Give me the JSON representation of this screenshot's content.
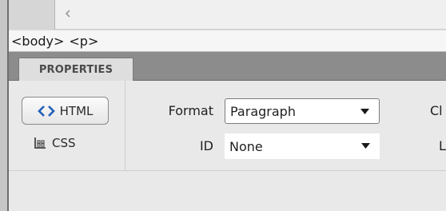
{
  "tag_selector": {
    "tags": [
      "<body>",
      "<p>"
    ]
  },
  "properties_panel": {
    "tab_label": "PROPERTIES",
    "html_button_label": "HTML",
    "css_button_label": "CSS",
    "format_label": "Format",
    "format_value": "Paragraph",
    "id_label": "ID",
    "id_value": "None",
    "class_label_partial": "Cl",
    "link_label_partial": "L"
  },
  "icons": {
    "html_icon": "code-brackets-icon",
    "css_icon": "css-layout-icon",
    "scroll_left": "chevron-left-icon",
    "dropdown": "caret-down-icon"
  },
  "colors": {
    "tab_strip": "#8c8c8c",
    "panel_bg": "#e9e9e9",
    "html_icon_blue": "#1f5fb8"
  }
}
